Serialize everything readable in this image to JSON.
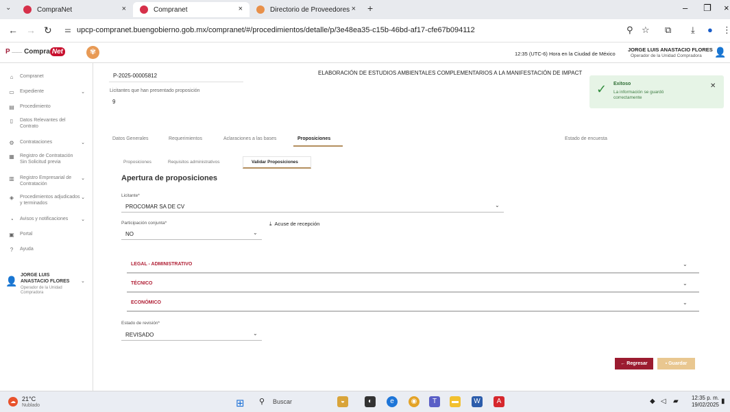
{
  "browser": {
    "tabs": [
      {
        "label": "CompraNet",
        "close": "×"
      },
      {
        "label": "Compranet",
        "close": "×"
      },
      {
        "label": "Directorio de Proveedores y C",
        "close": "×"
      }
    ],
    "url": "upcp-compranet.buengobierno.gob.mx/compranet/#/procedimientos/detalle/p/3e48ea35-c15b-46bd-af17-cfe67b094112"
  },
  "header": {
    "logo_prefix": "P",
    "logo_main": "Compra",
    "logo_pill": "Net",
    "time_text": "12:35 (UTC-6) Hora en la Ciudad de México",
    "user_name": "JORGE LUIS ANASTACIO FLORES",
    "user_role": "Operador de la Unidad Compradora"
  },
  "sidebar": {
    "items": [
      {
        "label": "Compranet"
      },
      {
        "label": "Expediente"
      },
      {
        "label": "Procedimiento"
      },
      {
        "label": "Datos Relevantes del Contrato"
      },
      {
        "label": "Contrataciones"
      },
      {
        "label": "Registro de Contratación Sin Solicitud previa"
      },
      {
        "label": "Registro Empresarial de Contratación"
      },
      {
        "label": "Procedimientos adjudicados y terminados"
      },
      {
        "label": "Avisos y notificaciones"
      },
      {
        "label": "Portal"
      },
      {
        "label": "Ayuda"
      }
    ],
    "user_name": "JORGE LUIS ANASTACIO FLORES",
    "user_role": "Operador de la Unidad Compradora"
  },
  "procedure": {
    "number": "P-2025-00005812",
    "description": "ELABORACIÓN DE ESTUDIOS AMBIENTALES COMPLEMENTARIOS A LA MANIFESTACIÓN DE IMPACT",
    "count_label": "Licitantes que han presentado proposición",
    "count_value": "9"
  },
  "toast": {
    "title": "Exitoso",
    "message": "La información se guardó correctamente"
  },
  "tabs_main": [
    {
      "label": "Datos Generales"
    },
    {
      "label": "Requerimientos"
    },
    {
      "label": "Aclaraciones a las bases"
    },
    {
      "label": "Proposiciones"
    }
  ],
  "estado_encuesta": "Estado de encuesta",
  "tabs_sub": [
    {
      "label": "Proposiciones"
    },
    {
      "label": "Requisitos administrativos"
    },
    {
      "label": "Validar Proposiciones"
    }
  ],
  "section_title": "Apertura de proposiciones",
  "form": {
    "licitante_label": "Licitante*",
    "licitante_value": "PROCOMAR SA DE CV",
    "participacion_label": "Participación conjunta*",
    "participacion_value": "NO",
    "acuse_label": "Acuse de recepción",
    "estado_label": "Estado de revisión*",
    "estado_value": "REVISADO"
  },
  "accordions": [
    {
      "label": "LEGAL - ADMINISTRATIVO"
    },
    {
      "label": "TÉCNICO"
    },
    {
      "label": "ECONÓMICO"
    }
  ],
  "buttons": {
    "regresar": "Regresar",
    "guardar": "Guardar"
  },
  "taskbar": {
    "temp": "21°C",
    "weather": "Nublado",
    "search": "Buscar",
    "time": "12:35 p. m.",
    "date": "19/02/2025"
  },
  "colors": {
    "brand_red": "#9b1b30",
    "accent_gold": "#b38e5d",
    "success_bg": "#e6f4e6"
  }
}
